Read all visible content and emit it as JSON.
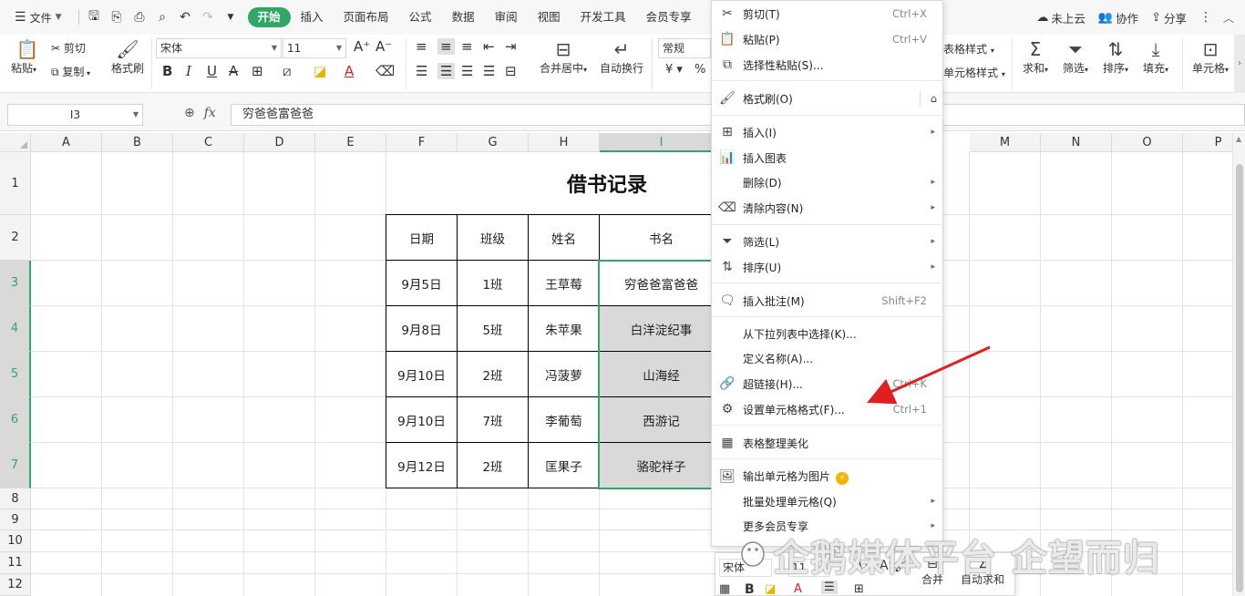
{
  "menubar": {
    "file_label": "文件",
    "tabs": [
      "开始",
      "插入",
      "页面布局",
      "公式",
      "数据",
      "审阅",
      "视图",
      "开发工具",
      "会员专享"
    ],
    "active_tab": "开始",
    "right": {
      "cloud": "未上云",
      "collab": "协作",
      "share": "分享"
    }
  },
  "ribbon": {
    "paste": "粘贴",
    "cut": "剪切",
    "copy": "复制",
    "format_painter": "格式刷",
    "font_name": "宋体",
    "font_size": "11",
    "merge_center": "合并居中",
    "wrap_text": "自动换行",
    "number_format": "常规",
    "currency": "¥",
    "percent": "%",
    "table_style": "表格样式",
    "cell_style": "单元格样式",
    "sum": "求和",
    "filter": "筛选",
    "sort": "排序",
    "fill": "填充",
    "cell": "单元格"
  },
  "formula_bar": {
    "name_box": "I3",
    "formula": "穷爸爸富爸爸"
  },
  "columns": [
    "A",
    "B",
    "C",
    "D",
    "E",
    "F",
    "G",
    "H",
    "I",
    "M",
    "N",
    "O",
    "P"
  ],
  "rows": [
    "1",
    "2",
    "3",
    "4",
    "5",
    "6",
    "7",
    "8",
    "9",
    "10",
    "11",
    "12"
  ],
  "sheet": {
    "title": "借书记录",
    "headers": [
      "日期",
      "班级",
      "姓名",
      "书名"
    ],
    "records": [
      [
        "9月5日",
        "1班",
        "王草莓",
        "穷爸爸富爸爸"
      ],
      [
        "9月8日",
        "5班",
        "朱苹果",
        "白洋淀纪事"
      ],
      [
        "9月10日",
        "2班",
        "冯菠萝",
        "山海经"
      ],
      [
        "9月10日",
        "7班",
        "李葡萄",
        "西游记"
      ],
      [
        "9月12日",
        "2班",
        "匡果子",
        "骆驼祥子"
      ]
    ]
  },
  "context_menu": {
    "items": [
      {
        "label": "剪切(T)",
        "shortcut": "Ctrl+X",
        "icon": "scissors-icon"
      },
      {
        "label": "粘贴(P)",
        "shortcut": "Ctrl+V",
        "icon": "clipboard-icon"
      },
      {
        "label": "选择性粘贴(S)...",
        "icon": "paste-special-icon"
      },
      {
        "label": "格式刷(O)",
        "icon": "brush-icon"
      },
      {
        "label": "插入(I)",
        "icon": "insert-icon"
      },
      {
        "label": "插入图表",
        "icon": "chart-icon"
      },
      {
        "label": "删除(D)",
        "icon": ""
      },
      {
        "label": "清除内容(N)",
        "icon": "eraser-icon"
      },
      {
        "label": "筛选(L)",
        "icon": "filter-icon"
      },
      {
        "label": "排序(U)",
        "icon": "sort-icon"
      },
      {
        "label": "插入批注(M)",
        "shortcut": "Shift+F2",
        "icon": "comment-icon"
      },
      {
        "label": "从下拉列表中选择(K)...",
        "icon": ""
      },
      {
        "label": "定义名称(A)...",
        "icon": ""
      },
      {
        "label": "超链接(H)...",
        "shortcut": "Ctrl+K",
        "icon": "link-icon"
      },
      {
        "label": "设置单元格格式(F)...",
        "shortcut": "Ctrl+1",
        "icon": "format-cells-icon"
      },
      {
        "label": "表格整理美化",
        "icon": "beautify-icon"
      },
      {
        "label": "输出单元格为图片",
        "icon": "image-export-icon"
      },
      {
        "label": "批量处理单元格(Q)",
        "icon": ""
      },
      {
        "label": "更多会员专享",
        "icon": ""
      }
    ]
  },
  "mini_toolbar": {
    "font": "宋体",
    "size": "11",
    "merge": "合并",
    "autosum": "自动求和"
  },
  "watermark": "企鹅媒体平台 企望而归",
  "colors": {
    "accent": "#2fa866",
    "arrow": "#e02020",
    "selected_fill": "#d9d9d9"
  }
}
